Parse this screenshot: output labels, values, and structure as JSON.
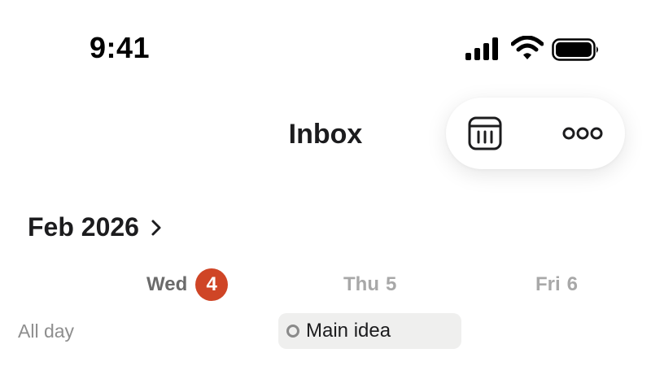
{
  "status_bar": {
    "time": "9:41",
    "icons": [
      "signal-icon",
      "wifi-icon",
      "battery-icon"
    ]
  },
  "header": {
    "title": "Inbox",
    "toolbar": {
      "calendar_icon": "calendar-icon",
      "more_icon": "more-icon"
    }
  },
  "calendar": {
    "month_label": "Feb 2026",
    "days": [
      {
        "weekday": "Wed",
        "date": "4",
        "is_today": true
      },
      {
        "weekday": "Thu",
        "date": "5",
        "is_today": false
      },
      {
        "weekday": "Fri",
        "date": "6",
        "is_today": false
      }
    ],
    "all_day_label": "All day",
    "all_day_events": [
      {
        "title": "Main idea",
        "day": "Thu 5"
      }
    ]
  },
  "colors": {
    "accent": "#cf4526",
    "today_text": "#6b6b6b",
    "other_day_text": "#a8a8a8",
    "event_chip_bg": "#efefee"
  }
}
